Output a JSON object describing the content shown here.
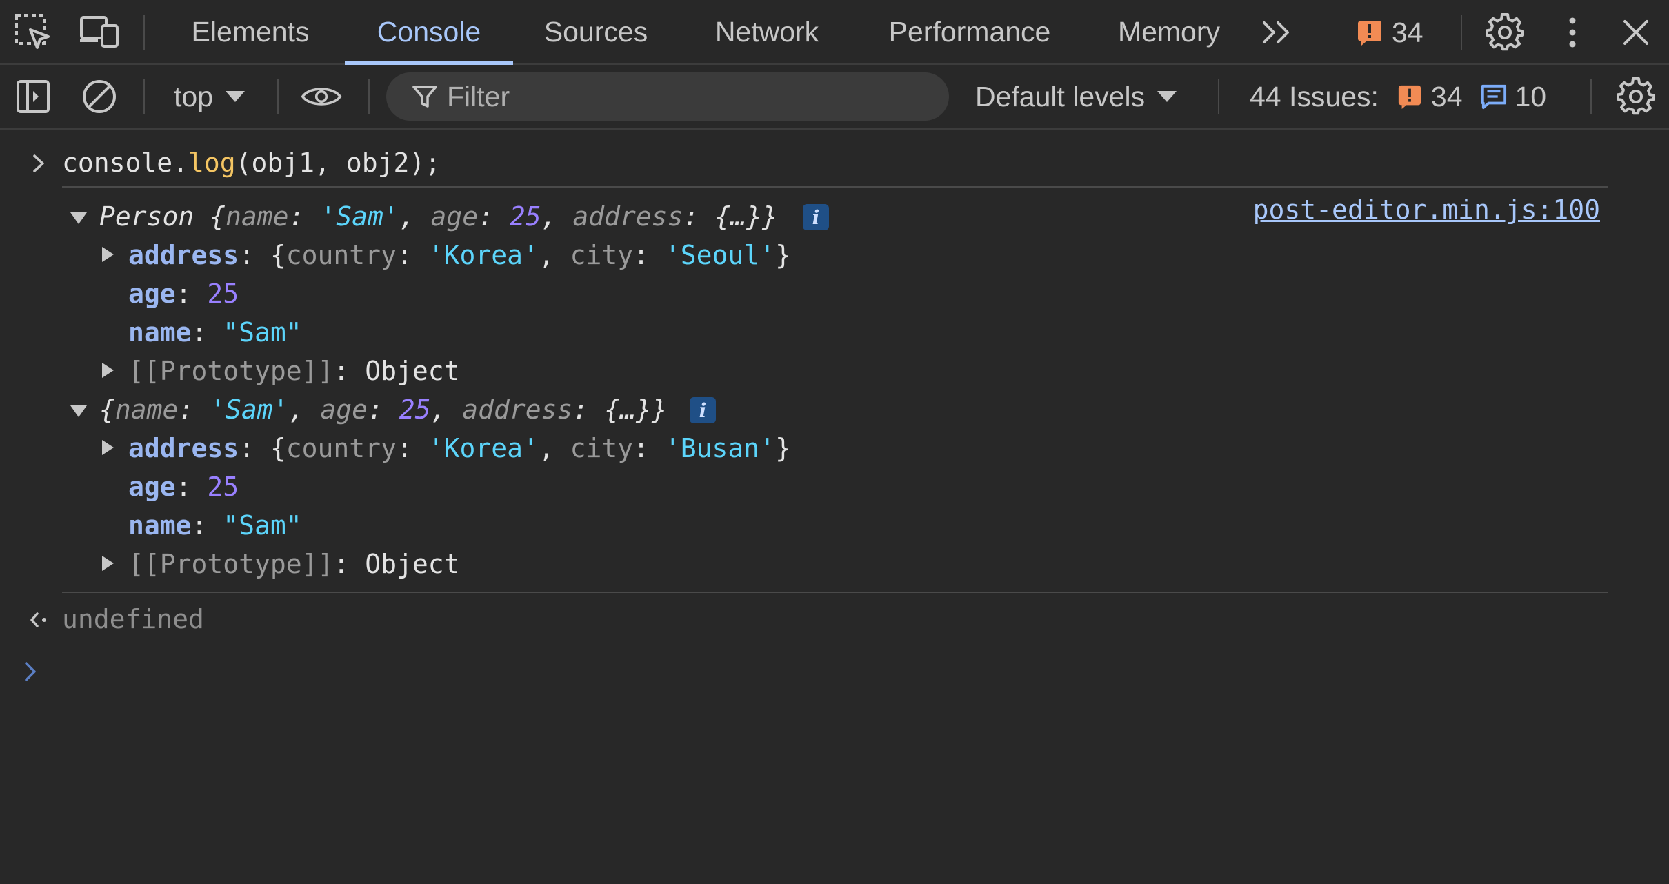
{
  "tabbar": {
    "tabs": [
      {
        "label": "Elements"
      },
      {
        "label": "Console"
      },
      {
        "label": "Sources"
      },
      {
        "label": "Network"
      },
      {
        "label": "Performance"
      },
      {
        "label": "Memory"
      }
    ],
    "active_tab": "Console",
    "issues_count": "34"
  },
  "toolbar": {
    "context": "top",
    "filter_placeholder": "Filter",
    "levels": "Default levels",
    "issues_label": "44 Issues:",
    "issues_warnings": "34",
    "issues_info": "10"
  },
  "console": {
    "input_command": {
      "obj": "console.",
      "fn": "log",
      "args": "(obj1, obj2);"
    },
    "source_link": "post-editor.min.js:100",
    "obj1": {
      "preview_class": "Person",
      "preview": {
        "name": "'Sam'",
        "age": "25",
        "address": "{…}"
      },
      "address": {
        "country": "'Korea'",
        "city": "'Seoul'"
      },
      "age": "25",
      "name": "\"Sam\"",
      "prototype": "Object"
    },
    "obj2": {
      "preview": {
        "name": "'Sam'",
        "age": "25",
        "address": "{…}"
      },
      "address": {
        "country": "'Korea'",
        "city": "'Busan'"
      },
      "age": "25",
      "name": "\"Sam\"",
      "prototype": "Object"
    },
    "return_value": "undefined"
  },
  "colors": {
    "accent": "#a8c7fa",
    "warning": "#f28b54",
    "string": "#5cd5fb",
    "number": "#9980ff"
  }
}
